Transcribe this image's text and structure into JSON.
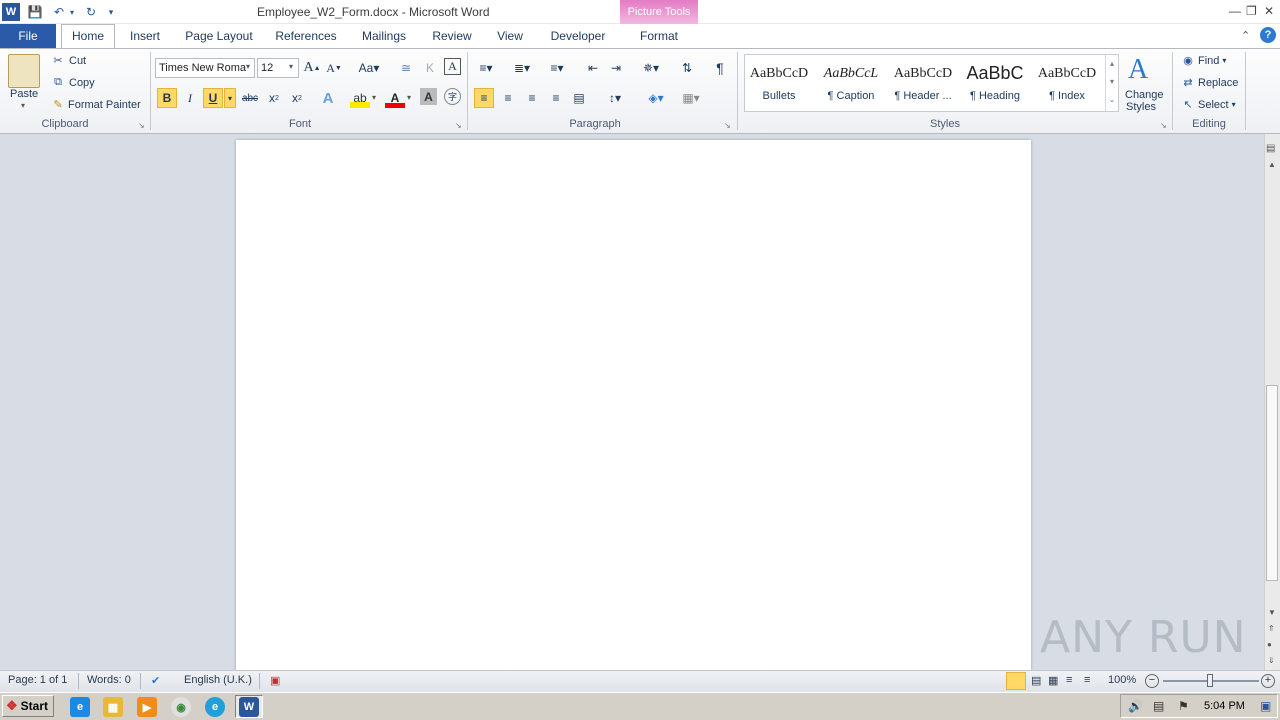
{
  "window": {
    "title": "Employee_W2_Form.docx - Microsoft Word",
    "contextual_tab_group": "Picture Tools"
  },
  "tabs": [
    "File",
    "Home",
    "Insert",
    "Page Layout",
    "References",
    "Mailings",
    "Review",
    "View",
    "Developer",
    "Format"
  ],
  "clipboard": {
    "paste_label": "Paste",
    "cut_label": "Cut",
    "copy_label": "Copy",
    "format_painter_label": "Format Painter",
    "group_label": "Clipboard"
  },
  "font": {
    "font_name": "Times New Roma",
    "font_size": "12",
    "group_label": "Font"
  },
  "paragraph": {
    "group_label": "Paragraph"
  },
  "styles": {
    "items": [
      {
        "sample": "AaBbCcD",
        "name": "Bullets"
      },
      {
        "sample": "AaBbCcL",
        "name": "¶ Caption"
      },
      {
        "sample": "AaBbCcD",
        "name": "¶ Header ..."
      },
      {
        "sample": "AaBbC",
        "name": "¶ Heading"
      },
      {
        "sample": "AaBbCcD",
        "name": "¶ Index"
      }
    ],
    "change_styles_line1": "Change",
    "change_styles_line2": "Styles",
    "group_label": "Styles"
  },
  "editing": {
    "find_label": "Find",
    "replace_label": "Replace",
    "select_label": "Select",
    "group_label": "Editing"
  },
  "statusbar": {
    "page": "Page: 1 of 1",
    "words": "Words: 0",
    "language": "English (U.K.)",
    "zoom": "100%"
  },
  "taskbar": {
    "start_label": "Start",
    "clock": "5:04 PM"
  },
  "watermark": "ANY RUN",
  "colors": {
    "file_tab": "#2a5aa8",
    "contextual_tab": "#e37cc4",
    "active_toggle": "#ffd866"
  }
}
